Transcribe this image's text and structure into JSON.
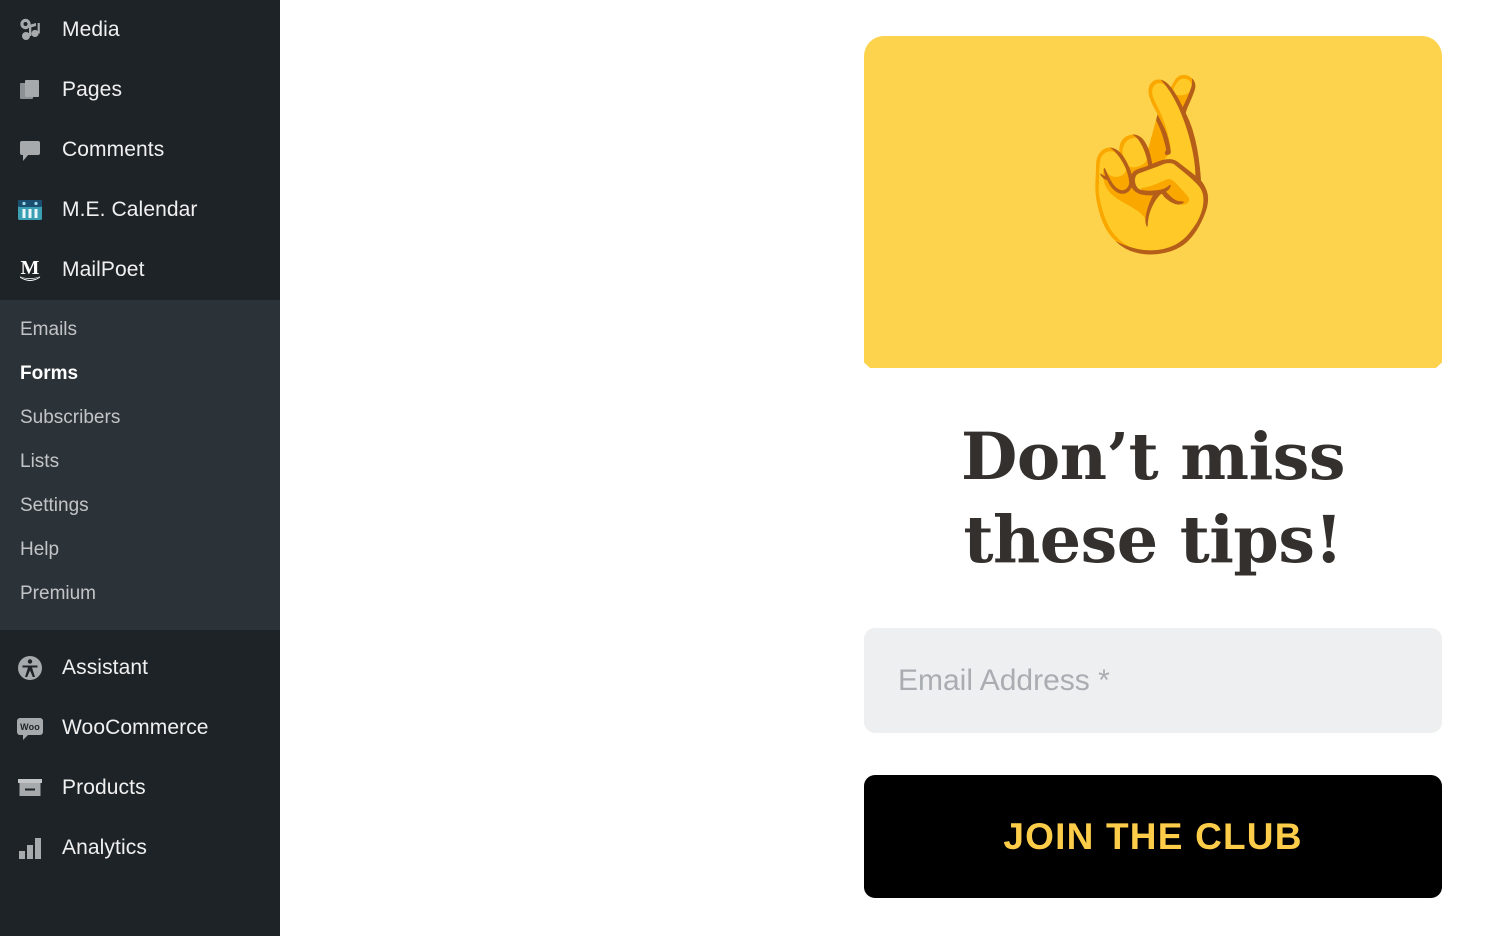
{
  "sidebar": {
    "background": "#1d2327",
    "submenu_background": "#2c3338",
    "items": [
      {
        "label": "Media",
        "icon": "media-icon"
      },
      {
        "label": "Pages",
        "icon": "pages-icon"
      },
      {
        "label": "Comments",
        "icon": "comments-icon"
      },
      {
        "label": "M.E. Calendar",
        "icon": "calendar-icon"
      },
      {
        "label": "MailPoet",
        "icon": "mailpoet-icon"
      }
    ],
    "submenu": [
      {
        "label": "Emails",
        "current": false
      },
      {
        "label": "Forms",
        "current": true
      },
      {
        "label": "Subscribers",
        "current": false
      },
      {
        "label": "Lists",
        "current": false
      },
      {
        "label": "Settings",
        "current": false
      },
      {
        "label": "Help",
        "current": false
      },
      {
        "label": "Premium",
        "current": false
      }
    ],
    "lower_items": [
      {
        "label": "Assistant",
        "icon": "accessibility-icon"
      },
      {
        "label": "WooCommerce",
        "icon": "woocommerce-icon"
      },
      {
        "label": "Products",
        "icon": "products-box-icon"
      },
      {
        "label": "Analytics",
        "icon": "analytics-bars-icon"
      }
    ]
  },
  "form": {
    "banner": {
      "color": "#fdd34e",
      "emoji": "🤞",
      "emoji_name": "crossed-fingers-emoji"
    },
    "headline": "Don’t miss\nthese tips!",
    "headline_line1": "Don’t miss",
    "headline_line2": "these tips!",
    "headline_color": "#33302e",
    "email": {
      "placeholder": "Email Address *",
      "value": "",
      "background": "#eeeff0"
    },
    "submit": {
      "label": "JOIN THE CLUB",
      "background": "#000000",
      "text_color": "#fdcd4a"
    }
  }
}
